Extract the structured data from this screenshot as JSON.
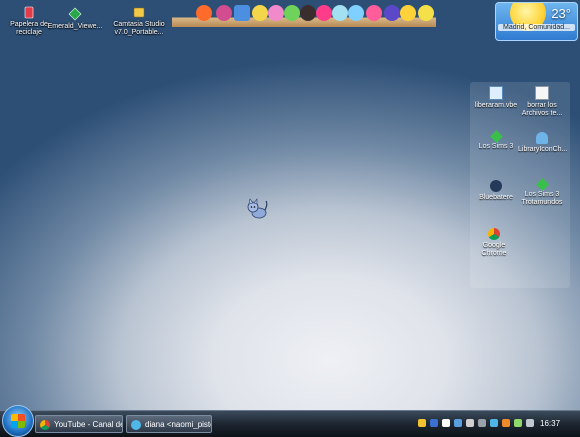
{
  "desktop_icons": [
    {
      "label": "Papelera de reciclaje",
      "icon": "recycle-bin-icon"
    },
    {
      "label": "Emerald_Viewe...",
      "icon": "app-icon"
    },
    {
      "label": "Camtasia Studio v7.0_Portable...",
      "icon": "folder-icon"
    }
  ],
  "weather": {
    "temp": "23°",
    "location": "Madrid, Comunidad..."
  },
  "panel_icons": [
    {
      "label": "liberaram.vbe",
      "icon": "script-icon"
    },
    {
      "label": "borrar los Archivos te...",
      "icon": "file-icon"
    },
    {
      "label": "Los Sims 3",
      "icon": "sims-icon"
    },
    {
      "label": "LibraryIconCh...",
      "icon": "library-icon"
    },
    {
      "label": "Bluebatere",
      "icon": "cat-icon"
    },
    {
      "label": "Los Sims 3 Trotamundos",
      "icon": "sims-icon"
    },
    {
      "label": "Google Chrome",
      "icon": "chrome-icon"
    }
  ],
  "taskbar": {
    "tasks": [
      {
        "label": "YouTube - Canal de ..."
      },
      {
        "label": "diana <naomi_piste..."
      }
    ],
    "clock": "16:37"
  },
  "colors": {
    "desktop_center": "#eef0f4",
    "desktop_edge": "#2d4f76",
    "taskbar": "#1d2630"
  }
}
